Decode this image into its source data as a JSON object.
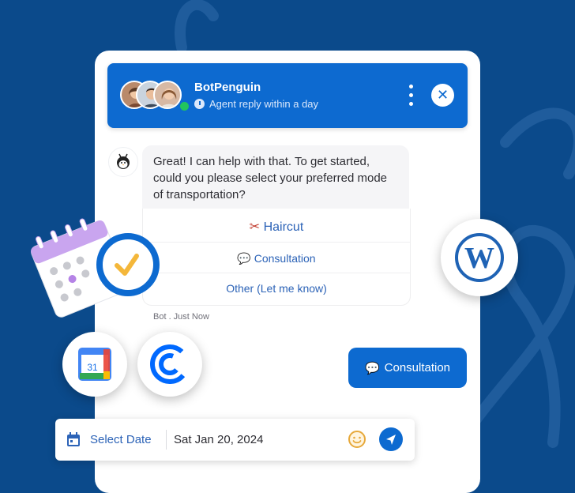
{
  "header": {
    "bot_name": "BotPenguin",
    "reply_status": "Agent reply within a day",
    "close_label": "✕"
  },
  "chat": {
    "bot_message": "Great! I can help with that. To get started, could you please select your preferred mode of transportation?",
    "options": [
      {
        "label": "Haircut",
        "icon": "scissors-icon"
      },
      {
        "label": "Consultation",
        "icon": "speech-bubble-icon"
      },
      {
        "label": "Other (Let me know)"
      }
    ],
    "timestamp": "Bot . Just Now",
    "user_reply": "Consultation"
  },
  "composer": {
    "select_date_label": "Select Date",
    "date_value": "Sat Jan 20, 2024"
  },
  "integrations": {
    "google_calendar_text": "31"
  },
  "colors": {
    "background": "#0b4a8b",
    "accent": "#0d6ad0",
    "link": "#2c63b7"
  }
}
